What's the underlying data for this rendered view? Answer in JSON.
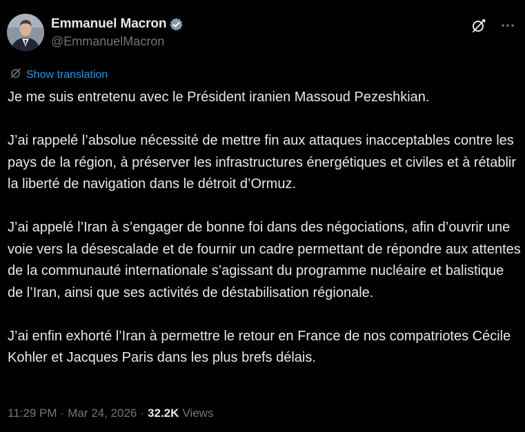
{
  "author": {
    "display_name": "Emmanuel Macron",
    "handle": "@EmmanuelMacron",
    "verified": true,
    "verified_color": "#829aab"
  },
  "header_actions": {
    "grok_icon": "grok-slash-circle-icon",
    "more_icon": "more-dots-icon"
  },
  "translation": {
    "label": "Show translation",
    "icon": "translate-icon",
    "color": "#1d9bf0"
  },
  "tweet": {
    "paragraphs": [
      "Je me suis entretenu avec le Président iranien Massoud Pezeshkian.",
      "J’ai rappelé l’absolue nécessité de mettre fin aux attaques inacceptables contre les pays de la région, à préserver les infrastructures énergétiques et civiles et à rétablir la liberté de navigation dans le détroit d’Ormuz.",
      "J’ai appelé l’Iran à s’engager de bonne foi dans des négociations, afin d’ouvrir une voie vers la désescalade et de fournir un cadre permettant de répondre aux attentes de la communauté internationale s’agissant du programme nucléaire et balistique de l’Iran, ainsi que ses activités de déstabilisation régionale.",
      "J’ai enfin exhorté l’Iran à permettre le retour en France de nos compatriotes Cécile Kohler et Jacques Paris dans les plus brefs délais."
    ]
  },
  "meta": {
    "time": "11:29 PM",
    "separator": "·",
    "date": "Mar 24, 2026",
    "views_count": "32.2K",
    "views_label": "Views"
  },
  "colors": {
    "background": "#000000",
    "text": "#e7e9ea",
    "secondary": "#71767b",
    "accent": "#1d9bf0"
  }
}
